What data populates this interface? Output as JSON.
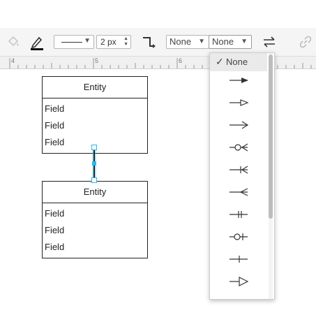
{
  "toolbar": {
    "line_width_value": "2 px",
    "line_start_value": "None",
    "line_end_value": "None"
  },
  "ruler": {
    "labels": [
      "4",
      "5",
      "6"
    ]
  },
  "entities": [
    {
      "title": "Entity",
      "fields": [
        "Field",
        "Field",
        "Field"
      ]
    },
    {
      "title": "Entity",
      "fields": [
        "Field",
        "Field",
        "Field"
      ]
    }
  ],
  "dropdown": {
    "selected_label": "None",
    "options": [
      "arrow-classic-icon",
      "arrow-open-triangle-icon",
      "arrow-open-icon",
      "er-zero-to-many-icon",
      "er-one-to-many-icon",
      "er-many-icon",
      "er-mandatory-one-icon",
      "er-zero-to-one-icon",
      "er-one-icon",
      "arrow-block-open-icon"
    ]
  },
  "colors": {
    "accent": "#29b6f2",
    "toolbar_bg": "#f5f5f5",
    "border": "#b5b5b5"
  }
}
